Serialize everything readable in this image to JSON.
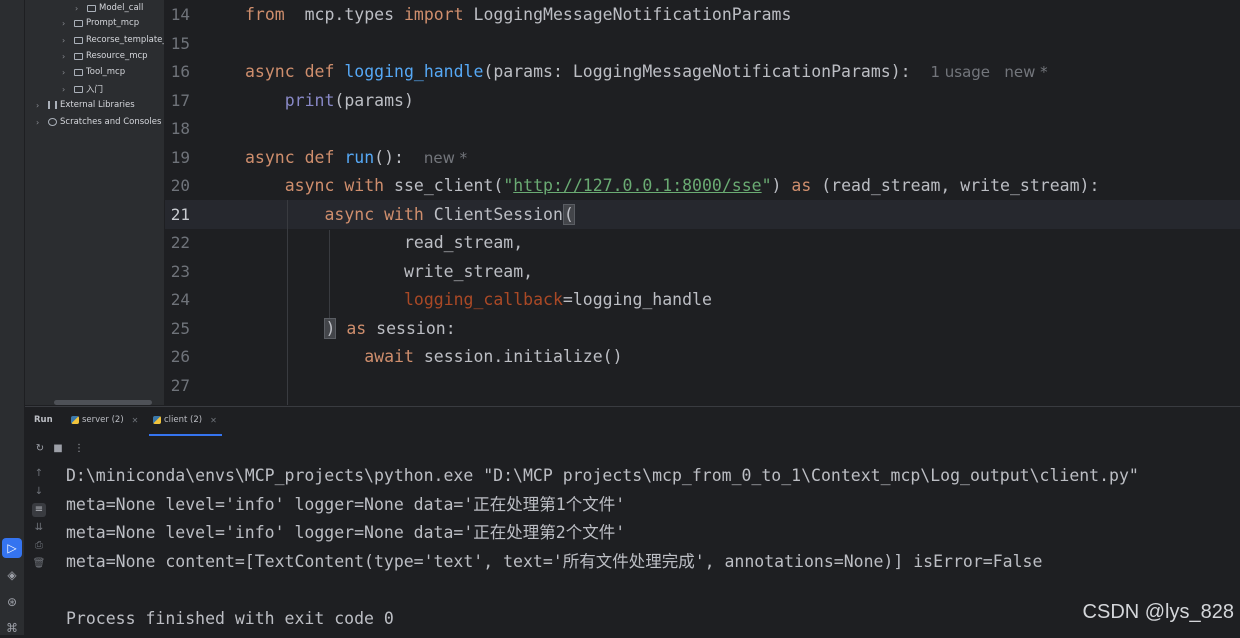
{
  "project_tree": [
    {
      "label": "Model_call",
      "kind": "folder"
    },
    {
      "label": "Prompt_mcp",
      "kind": "folder"
    },
    {
      "label": "Recorse_template_",
      "kind": "folder"
    },
    {
      "label": "Resource_mcp",
      "kind": "folder"
    },
    {
      "label": "Tool_mcp",
      "kind": "folder"
    },
    {
      "label": "入门",
      "kind": "folder"
    },
    {
      "label": "External Libraries",
      "kind": "library"
    },
    {
      "label": "Scratches and Consoles",
      "kind": "scratch"
    }
  ],
  "editor": {
    "current_line": 21,
    "line_numbers": [
      "14",
      "15",
      "16",
      "17",
      "18",
      "19",
      "20",
      "21",
      "22",
      "23",
      "24",
      "25",
      "26",
      "27"
    ],
    "lines": [
      {
        "tokens": [
          [
            "kw",
            "from"
          ],
          [
            "",
            "  mcp.types "
          ],
          [
            "kw",
            "import"
          ],
          [
            "",
            " LoggingMessageNotificationParams"
          ]
        ]
      },
      {
        "tokens": []
      },
      {
        "tokens": [
          [
            "kw",
            "async def"
          ],
          [
            "",
            " "
          ],
          [
            "fn",
            "logging_handle"
          ],
          [
            "",
            "(params: LoggingMessageNotificationParams):  "
          ],
          [
            "hint",
            "1 usage   new *"
          ]
        ]
      },
      {
        "tokens": [
          [
            "",
            "    "
          ],
          [
            "bi",
            "print"
          ],
          [
            "",
            "(params)"
          ]
        ]
      },
      {
        "tokens": []
      },
      {
        "tokens": [
          [
            "kw",
            "async def"
          ],
          [
            "",
            " "
          ],
          [
            "fn",
            "run"
          ],
          [
            "",
            "():  "
          ],
          [
            "hint",
            "new *"
          ]
        ]
      },
      {
        "tokens": [
          [
            "",
            "    "
          ],
          [
            "kw",
            "async with"
          ],
          [
            "",
            " sse_client("
          ],
          [
            "str",
            "\""
          ],
          [
            "url",
            "http://127.0.0.1:8000/sse"
          ],
          [
            "str",
            "\""
          ],
          [
            "",
            ") "
          ],
          [
            "kw",
            "as"
          ],
          [
            "",
            " (read_stream, write_stream):"
          ]
        ]
      },
      {
        "tokens": [
          [
            "",
            "        "
          ],
          [
            "kw",
            "async with"
          ],
          [
            "",
            " ClientSession"
          ],
          [
            "brk",
            "("
          ]
        ]
      },
      {
        "tokens": [
          [
            "",
            "                read_stream,"
          ]
        ]
      },
      {
        "tokens": [
          [
            "",
            "                write_stream,"
          ]
        ]
      },
      {
        "tokens": [
          [
            "",
            "                "
          ],
          [
            "kwarg",
            "logging_callback"
          ],
          [
            "",
            "=logging_handle"
          ]
        ]
      },
      {
        "tokens": [
          [
            "",
            "        "
          ],
          [
            "brk",
            ")"
          ],
          [
            "",
            " "
          ],
          [
            "kw",
            "as"
          ],
          [
            "",
            " session:"
          ]
        ]
      },
      {
        "tokens": [
          [
            "",
            "            "
          ],
          [
            "kw",
            "await"
          ],
          [
            "",
            " session.initialize()"
          ]
        ]
      },
      {
        "tokens": []
      }
    ]
  },
  "run_panel": {
    "title": "Run",
    "tabs": [
      {
        "label": "server (2)",
        "active": false
      },
      {
        "label": "client (2)",
        "active": true
      }
    ],
    "output": [
      "D:\\miniconda\\envs\\MCP_projects\\python.exe \"D:\\MCP projects\\mcp_from_0_to_1\\Context_mcp\\Log_output\\client.py\"",
      "meta=None level='info' logger=None data='正在处理第1个文件'",
      "meta=None level='info' logger=None data='正在处理第2个文件'",
      "meta=None content=[TextContent(type='text', text='所有文件处理完成', annotations=None)] isError=False",
      "",
      "Process finished with exit code 0"
    ]
  },
  "watermark": "CSDN @lys_828",
  "colors": {
    "keyword": "#cf8e6d",
    "function": "#56a8f5",
    "builtin": "#8888c6",
    "string": "#6aab73",
    "kwarg": "#aa4926",
    "accent": "#3574f0"
  }
}
